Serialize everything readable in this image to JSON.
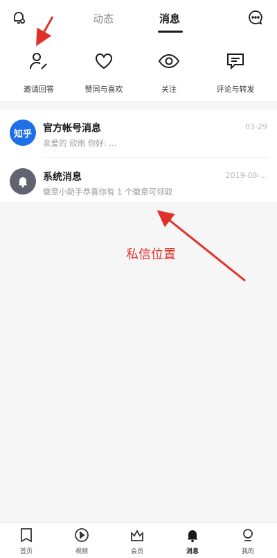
{
  "header": {
    "tabs": [
      {
        "label": "动态",
        "active": false
      },
      {
        "label": "消息",
        "active": true
      }
    ],
    "left_icon": "bell-settings-icon",
    "right_icon": "chat-bubble-icon"
  },
  "quick_actions": [
    {
      "label": "邀请回答",
      "icon": "user-pen-icon"
    },
    {
      "label": "赞同与喜欢",
      "icon": "heart-icon"
    },
    {
      "label": "关注",
      "icon": "eye-icon"
    },
    {
      "label": "评论与转发",
      "icon": "comment-icon"
    }
  ],
  "messages": [
    {
      "avatar_text": "知乎",
      "title": "官方帐号消息",
      "subtitle": "亲爱的 欣雨 你好: ...",
      "time": "03-29",
      "avatar_color": "#1e6fe8"
    },
    {
      "avatar_icon": "bell-icon",
      "title": "系统消息",
      "subtitle": "徽章小助手恭喜你有 1 个徽章可领取",
      "time": "2019-08-...",
      "avatar_color": "#5f6470"
    }
  ],
  "annotation": {
    "text": "私信位置",
    "color": "#e0312a"
  },
  "bottom_nav": [
    {
      "label": "首页",
      "icon": "home-book-icon"
    },
    {
      "label": "视频",
      "icon": "video-play-icon"
    },
    {
      "label": "会员",
      "icon": "crown-icon"
    },
    {
      "label": "消息",
      "icon": "bell-icon"
    },
    {
      "label": "我的",
      "icon": "profile-icon"
    }
  ],
  "colors": {
    "accent": "#1a1a1a",
    "annotation": "#e0312a",
    "brand": "#1e6fe8"
  }
}
